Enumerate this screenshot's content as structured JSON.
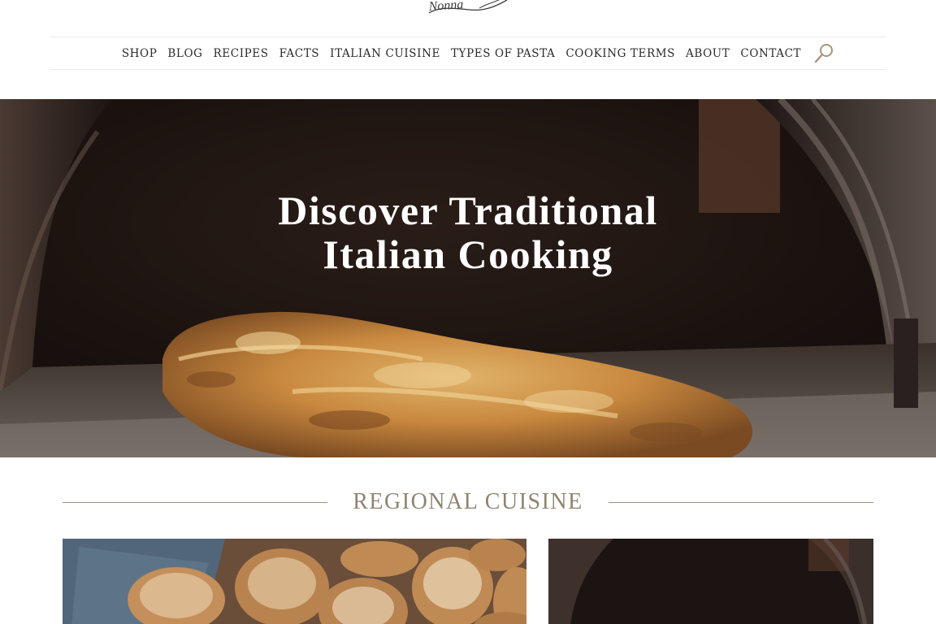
{
  "site": {
    "logo_text": "Nonna"
  },
  "nav": {
    "items": [
      {
        "label": "SHOP"
      },
      {
        "label": "BLOG"
      },
      {
        "label": "RECIPES"
      },
      {
        "label": "FACTS"
      },
      {
        "label": "ITALIAN CUISINE"
      },
      {
        "label": "TYPES OF PASTA"
      },
      {
        "label": "COOKING TERMS"
      },
      {
        "label": "ABOUT"
      },
      {
        "label": "CONTACT"
      }
    ],
    "search_icon": "search-icon"
  },
  "hero": {
    "title_line1": "Discover Traditional",
    "title_line2": "Italian Cooking"
  },
  "regional": {
    "heading": "REGIONAL CUISINE"
  },
  "colors": {
    "accent": "#9c917f",
    "heading": "#8f8470",
    "text": "#2b2b2b"
  }
}
